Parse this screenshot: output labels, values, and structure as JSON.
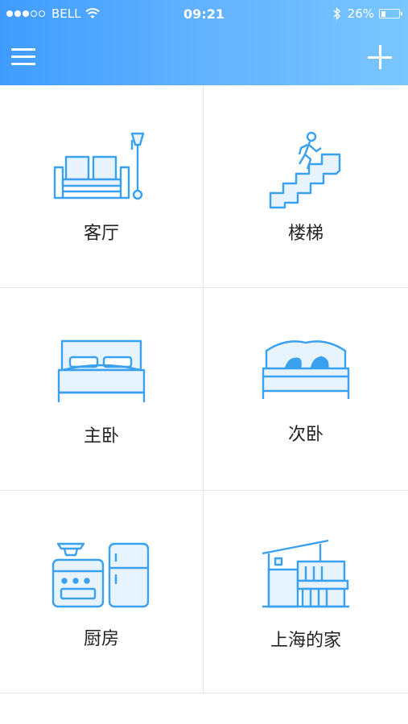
{
  "status_bar": {
    "carrier": "BELL",
    "time": "09:21",
    "battery_percent": "26%",
    "battery_level": 0.26,
    "signal_dots": [
      true,
      true,
      true,
      false,
      false
    ]
  },
  "header": {
    "menu_icon": "hamburger-menu-icon",
    "add_icon": "plus-icon",
    "gradient": [
      "#3f9cff",
      "#7ac6ff"
    ]
  },
  "accent_color": "#3aa0f0",
  "rooms": [
    {
      "label": "客厅",
      "icon": "living-room-icon"
    },
    {
      "label": "楼梯",
      "icon": "stairs-icon"
    },
    {
      "label": "主卧",
      "icon": "master-bedroom-icon"
    },
    {
      "label": "次卧",
      "icon": "second-bedroom-icon"
    },
    {
      "label": "厨房",
      "icon": "kitchen-icon"
    },
    {
      "label": "上海的家",
      "icon": "house-icon"
    }
  ]
}
